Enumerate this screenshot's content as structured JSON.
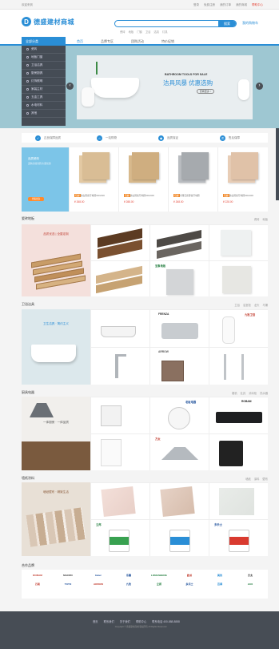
{
  "topbar": {
    "welcome": "欢迎来到",
    "links": [
      "登录",
      "免费注册",
      "我的订单",
      "我的商城",
      "帮助中心"
    ]
  },
  "header": {
    "logo_text": "德盛建材商城",
    "search_button": "搜索",
    "hotwords": [
      "瓷砖",
      "地板",
      "门窗",
      "卫浴",
      "洁具",
      "灯具"
    ],
    "cart": "我的购物车"
  },
  "nav": {
    "category": "全部分类",
    "links": [
      "首页",
      "品牌专区",
      "团购活动",
      "特价促销"
    ]
  },
  "sidebar": {
    "items": [
      "瓷砖",
      "地板门窗",
      "卫浴洁具",
      "厨房厨具",
      "灯饰照明",
      "家装主材",
      "五金工具",
      "水电材料",
      "其他"
    ]
  },
  "banner": {
    "en": "BATHROOM TOOLS FOR SALE",
    "cn": "洁具风暴 优惠选购",
    "button": "查看更多 >"
  },
  "services": [
    "正品保障品质",
    "一站购物",
    "品质保证",
    "售后保障"
  ],
  "promo": {
    "title": "品质瓷砖",
    "sub": "选购高档瓷砖|大量优惠",
    "button": "查看更多"
  },
  "tiles": [
    {
      "tag": "包邮",
      "name": "仿古砖客厅地砖600x600",
      "price": "¥ 268.00",
      "color": "#e3c9a3"
    },
    {
      "tag": "包邮",
      "name": "仿古砖客厅地砖600x600",
      "price": "¥ 288.00",
      "color": "#d8b98c"
    },
    {
      "tag": "包邮",
      "name": "大理石瓷砖客厅地砖",
      "price": "¥ 268.00",
      "color": "#b9bcc0"
    },
    {
      "tag": "包邮",
      "name": "仿古砖客厅地砖600x600",
      "price": "¥ 228.00",
      "color": "#e8cdb6"
    }
  ],
  "sections": [
    {
      "title": "瓷砖地板",
      "hero": "品质优选 | 全屋定制",
      "more": [
        "瓷砖",
        "地板"
      ],
      "brands": [
        "圣象地板"
      ]
    },
    {
      "title": "卫浴洁具",
      "hero": "卫生洁具 · 简约主义",
      "more": [
        "卫浴",
        "浴室柜",
        "龙头",
        "马桶"
      ],
      "brands": [
        "FRENZA",
        "九牧卫浴",
        "ARROW"
      ]
    },
    {
      "title": "厨具电器",
      "hero": "一体厨房 · 一体品质",
      "more": [
        "烟机",
        "灶具",
        "消毒柜",
        "热水器"
      ],
      "brands": [
        "老板电器",
        "ROBAM",
        "方太"
      ]
    },
    {
      "title": "墙纸涂料",
      "hero": "墙纸壁布 · 精致生活",
      "more": [
        "墙纸",
        "涂料",
        "壁布"
      ],
      "brands": [
        "立邦",
        "多乐士"
      ]
    }
  ],
  "brands_title": "合作品牌",
  "brands": [
    "ROBAM",
    "MACRO",
    "Haier",
    "东鹏",
    "LONGSHENG",
    "欧派",
    "美的",
    "方太",
    "万和",
    "TOTO",
    "ARROW",
    "九牧",
    "立邦",
    "多乐士",
    "百得",
    "AUX"
  ],
  "footer": {
    "links": [
      "首页",
      "联系我们",
      "关于我们",
      "帮助中心",
      "联系电话 400-888-8888"
    ],
    "copy": "Copyright © 德盛建材商城 版权所有 All Rights Reserved"
  }
}
